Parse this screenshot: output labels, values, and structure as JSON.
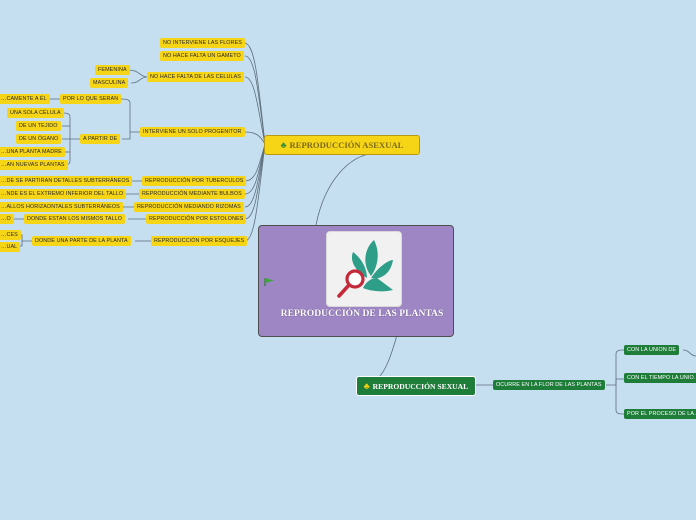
{
  "center": {
    "title": "REPRODUCCIÓN DE LAS PLANTAS"
  },
  "asexual": {
    "title": "REPRODUCCIÓN ASEXUAL",
    "icon": "clover-icon",
    "accent": "#f6d416",
    "items": [
      "NO INTERVIENE LAS FLORES",
      "NO HACE FALTA UN GAMETO",
      "NO HACE FALTA DE LAS CELULAS",
      "INTERVIENE UN SOLO PROGENITOR",
      "REPRODUCCIÓN POR TUBERCULOS",
      "REPRODUCCIÓN MEDIANTE BULBOS",
      "REPRODUCCIÓN MEDIANDO RIZOMAS",
      "REPRODUCCIÓN POR ESTOLONES",
      "REPRODUCCIÓN POR ESQUEJES"
    ],
    "celulas_sub": [
      "FEMENINA",
      "MASCULINA"
    ],
    "progenitor_sub": [
      "POR LO QUE SERAN",
      "A PARTIR DE"
    ],
    "seran_sub": [
      "…CAMENTE A ÉL"
    ],
    "a_partir_sub": [
      "UNA SOLA CÉLULA",
      "DE UN TEJIDO",
      "DE UN ÓGANO",
      "…UNA PLANTA MADRE",
      "…AN NUEVAS PLANTAS"
    ],
    "tuberculos_sub": "…DE SE PARTIRAN DETALLES SUBTERRÁNEOS",
    "bulbos_sub": "…NDE ES EL EXTREMO INFERIOR DEL TALLO",
    "rizomas_sub": "…ALLOS HORIZAONTALES SUBTERRÁNEOS",
    "estolones_sub": [
      "…O",
      "DONDE ESTAN LOS MISMOS TALLO"
    ],
    "esquejes_sub": "DONDE UNA PARTE DE LA PLANTA",
    "esquejes_sub2": [
      "…CES",
      "…UAL"
    ]
  },
  "sexual": {
    "title": "REPRODUCCIÓN SEXUAL",
    "icon": "clover-icon",
    "accent": "#1f7d3a",
    "item": "OCURRE EN LA FLOR DE LAS PLANTAS",
    "sub": [
      "CON LA UNION DE",
      "CON EL TIEMPO LA UNIO…",
      "POR EL PROCESO DE LA…"
    ]
  },
  "colors": {
    "background": "#c5def0",
    "central": "#9e86c4",
    "line": "#5a5a5a",
    "plant_teal": "#2e9e88",
    "magnifier_red": "#c42a3a",
    "flag_green": "#3aa63a"
  }
}
